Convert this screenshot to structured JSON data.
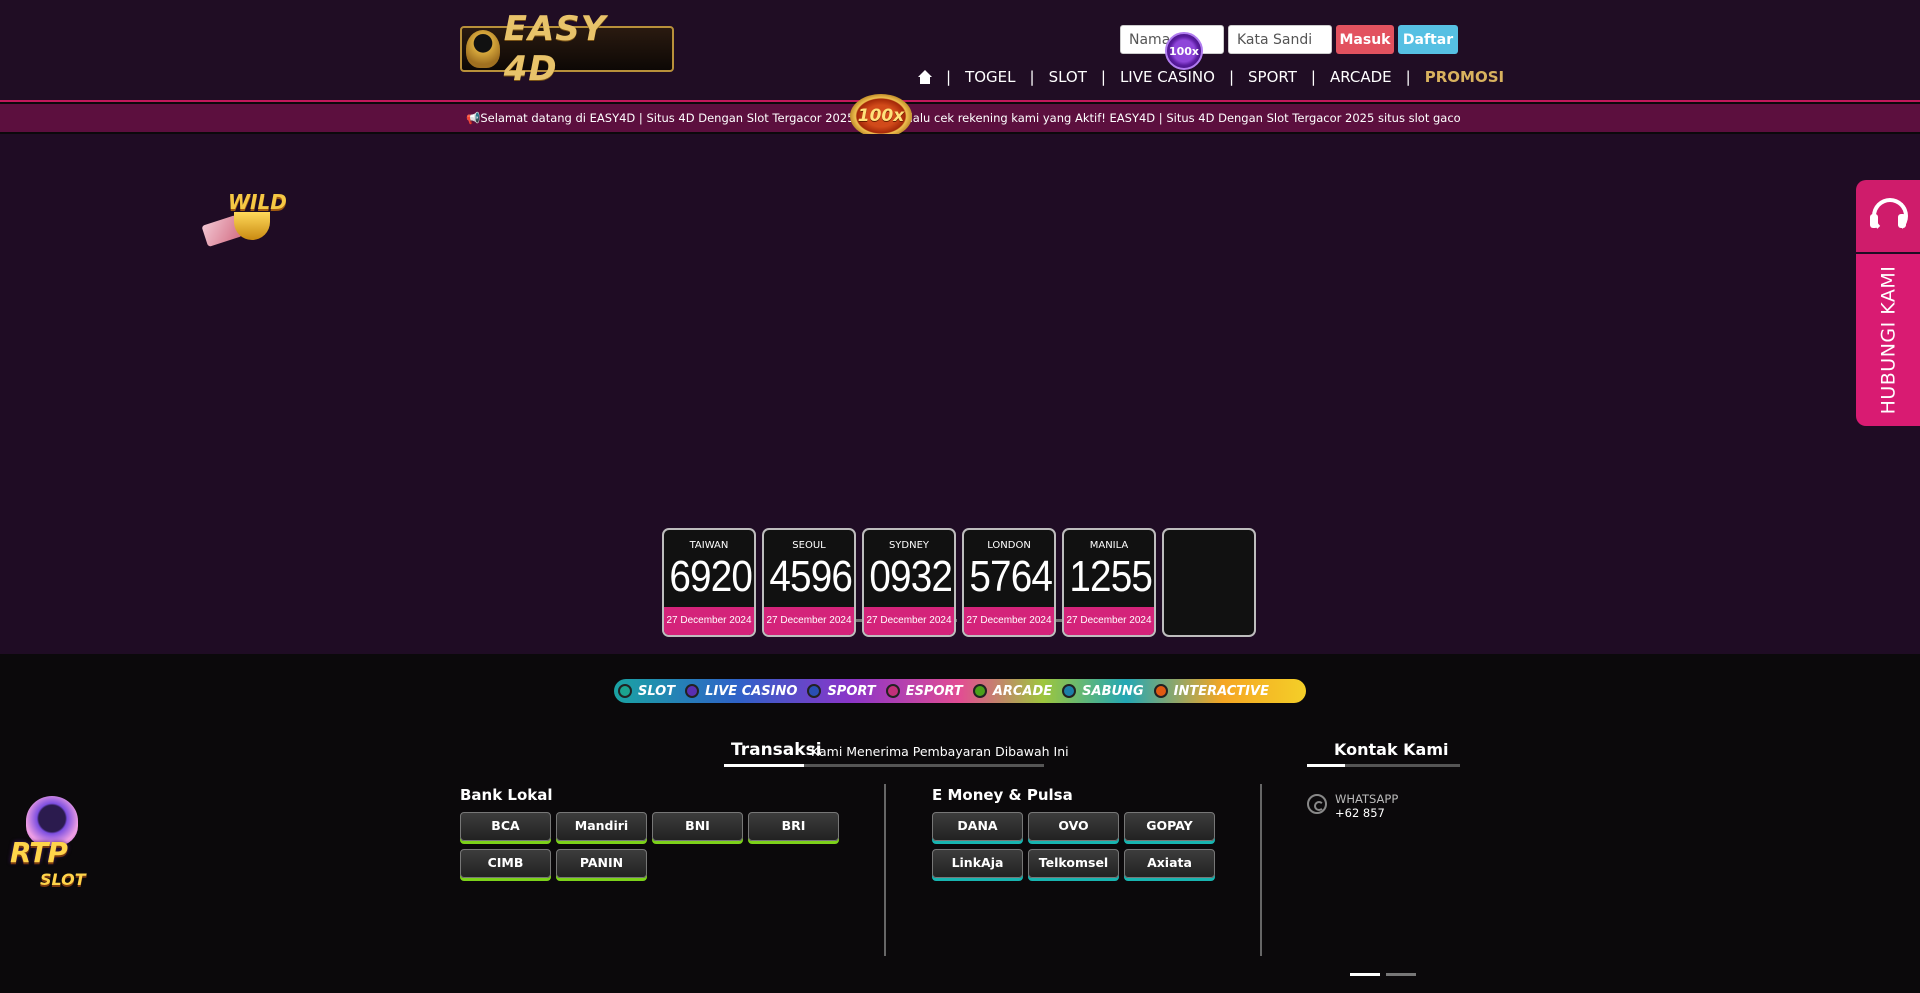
{
  "brand": {
    "logo_text": "EASY 4D"
  },
  "login": {
    "username_placeholder": "Nama",
    "password_placeholder": "Kata Sandi",
    "login_label": "Masuk",
    "register_label": "Daftar"
  },
  "promo_badge_small": "100x",
  "promo_badge_large": "100x",
  "nav": {
    "home_icon": "home-icon",
    "items": [
      "TOGEL",
      "SLOT",
      "LIVE CASINO",
      "SPORT",
      "ARCADE",
      "PROMOSI"
    ],
    "separator": "|"
  },
  "marquee": {
    "text": "📢Selamat datang di EASY4D | Situs 4D Dengan Slot Tergacor 2025 Harap selalu cek rekening kami yang Aktif! EASY4D | Situs 4D Dengan Slot Tergacor 2025 situs slot gacor aman dan terpercaya"
  },
  "wild_badge": "WILD",
  "slider": {
    "slide_count": 8,
    "active_index": 0
  },
  "results": [
    {
      "city": "TAIWAN",
      "number": "6920",
      "date": "27 December 2024"
    },
    {
      "city": "SEOUL",
      "number": "4596",
      "date": "27 December 2024"
    },
    {
      "city": "SYDNEY",
      "number": "0932",
      "date": "27 December 2024"
    },
    {
      "city": "LONDON",
      "number": "5764",
      "date": "27 December 2024"
    },
    {
      "city": "MANILA",
      "number": "1255",
      "date": "27 December 2024"
    }
  ],
  "categories": [
    {
      "label": "SLOT",
      "dot": "#1ba38f"
    },
    {
      "label": "LIVE CASINO",
      "dot": "#5a2fb0"
    },
    {
      "label": "SPORT",
      "dot": "#2a4fb3"
    },
    {
      "label": "ESPORT",
      "dot": "#c2307a"
    },
    {
      "label": "ARCADE",
      "dot": "#4aa01a"
    },
    {
      "label": "SABUNG",
      "dot": "#1c7ea8"
    },
    {
      "label": "INTERACTIVE",
      "dot": "#e05a12"
    }
  ],
  "transactions": {
    "title": "Transaksi",
    "subtitle": "Kami Menerima Pembayaran Dibawah Ini",
    "bank_heading": "Bank Lokal",
    "banks": [
      "BCA",
      "Mandiri",
      "BNI",
      "BRI",
      "CIMB",
      "PANIN"
    ],
    "emoney_heading": "E Money & Pulsa",
    "emoney": [
      "DANA",
      "OVO",
      "GOPAY",
      "LinkAja",
      "Telkomsel",
      "Axiata"
    ]
  },
  "contact": {
    "title": "Kontak Kami",
    "whatsapp_label": "WHATSAPP",
    "whatsapp_number": "+62 857",
    "side_label": "HUBUNGI KAMI"
  },
  "rtp": {
    "title": "RTP",
    "subtitle": "SLOT"
  },
  "colors": {
    "header_bg": "#200d24",
    "accent_pink": "#d91b72",
    "promo_gold": "#d9b25e",
    "login_red": "#e2525f",
    "register_blue": "#56c0e3"
  }
}
